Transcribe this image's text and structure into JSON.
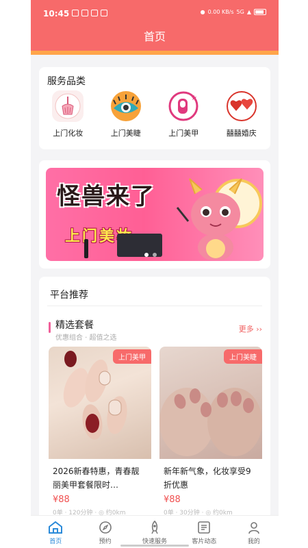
{
  "status": {
    "time": "10:45",
    "net_speed": "0.00 KB/s",
    "signal": "5G"
  },
  "header": {
    "title": "首页"
  },
  "services": {
    "title": "服务品类",
    "items": [
      {
        "label": "上门化妆",
        "icon": "makeup-brush-icon"
      },
      {
        "label": "上门美睫",
        "icon": "eyelash-icon"
      },
      {
        "label": "上门美甲",
        "icon": "nail-icon"
      },
      {
        "label": "囍囍婚庆",
        "icon": "wedding-hearts-icon"
      }
    ]
  },
  "banner": {
    "line1": "怪兽来了",
    "line2": "上门美妆"
  },
  "recommend": {
    "title": "平台推荐",
    "package_title": "精选套餐",
    "package_subtitle": "优惠组合 · 超值之选",
    "more": "更多 ››",
    "products": [
      {
        "tag": "上门美甲",
        "name": "2026新春特惠，青春靓丽美甲套餐限时…",
        "price": "¥88",
        "meta": "0单 · 120分钟 · ◎ 约0km"
      },
      {
        "tag": "上门美睫",
        "name": "新年新气象，化妆享受9折优惠",
        "price": "¥88",
        "meta": "0单 · 30分钟 · ◎ 约0km"
      }
    ]
  },
  "tabbar": [
    {
      "label": "首页",
      "icon": "home-icon",
      "active": true
    },
    {
      "label": "预约",
      "icon": "compass-icon",
      "active": false
    },
    {
      "label": "快速服务",
      "icon": "rocket-icon",
      "active": false
    },
    {
      "label": "客片动态",
      "icon": "feed-icon",
      "active": false
    },
    {
      "label": "我的",
      "icon": "user-icon",
      "active": false
    }
  ],
  "colors": {
    "header": "#f76a6a",
    "stripe": "#ffa54a",
    "accent": "#f05050",
    "tab_active": "#2a8ad9"
  }
}
